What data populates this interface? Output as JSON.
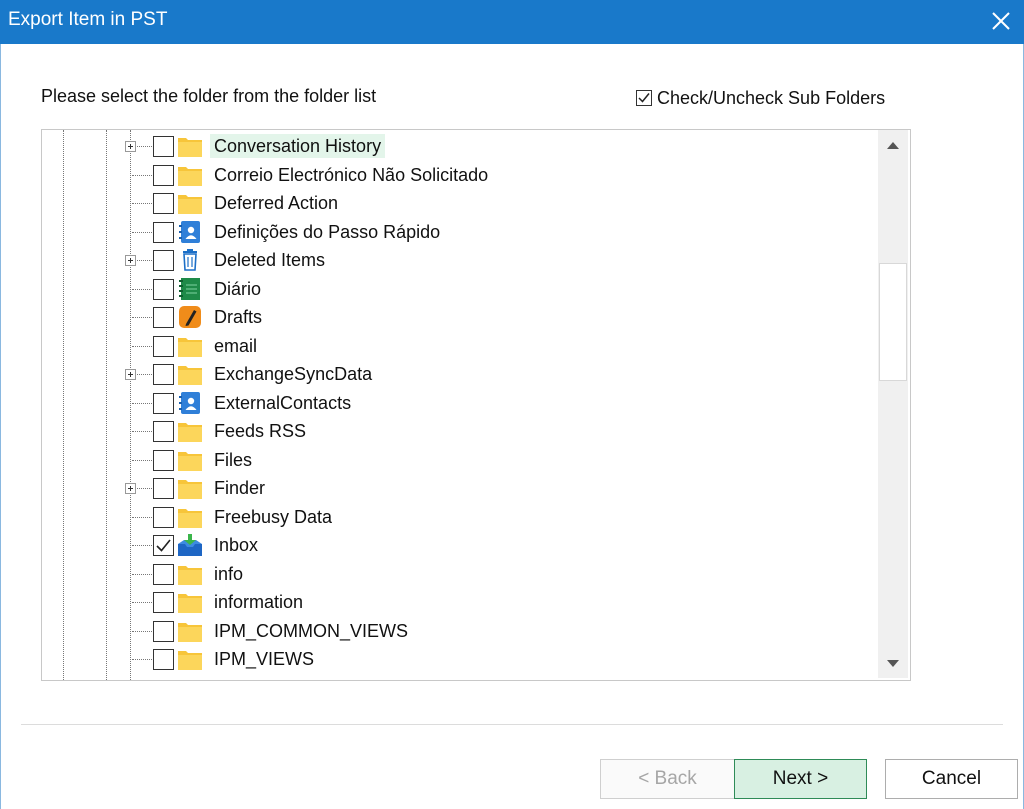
{
  "window": {
    "title": "Export Item in PST"
  },
  "dialog": {
    "prompt": "Please select the folder from the folder list",
    "subfolders_label": "Check/Uncheck Sub Folders",
    "subfolders_checked": true
  },
  "tree": {
    "items": [
      {
        "label": "Conversation History",
        "icon": "folder-icon",
        "expandable": true,
        "checked": false,
        "selected": true
      },
      {
        "label": "Correio Electrónico Não Solicitado",
        "icon": "folder-icon",
        "expandable": false,
        "checked": false
      },
      {
        "label": "Deferred Action",
        "icon": "folder-icon",
        "expandable": false,
        "checked": false
      },
      {
        "label": "Definições do Passo Rápido",
        "icon": "contacts-icon",
        "expandable": false,
        "checked": false
      },
      {
        "label": "Deleted Items",
        "icon": "trash-icon",
        "expandable": true,
        "checked": false
      },
      {
        "label": "Diário",
        "icon": "journal-icon",
        "expandable": false,
        "checked": false
      },
      {
        "label": "Drafts",
        "icon": "drafts-icon",
        "expandable": false,
        "checked": false
      },
      {
        "label": "email",
        "icon": "folder-icon",
        "expandable": false,
        "checked": false
      },
      {
        "label": "ExchangeSyncData",
        "icon": "folder-icon",
        "expandable": true,
        "checked": false
      },
      {
        "label": "ExternalContacts",
        "icon": "contacts-icon",
        "expandable": false,
        "checked": false
      },
      {
        "label": "Feeds RSS",
        "icon": "folder-icon",
        "expandable": false,
        "checked": false
      },
      {
        "label": "Files",
        "icon": "folder-icon",
        "expandable": false,
        "checked": false
      },
      {
        "label": "Finder",
        "icon": "folder-icon",
        "expandable": true,
        "checked": false
      },
      {
        "label": "Freebusy Data",
        "icon": "folder-icon",
        "expandable": false,
        "checked": false
      },
      {
        "label": "Inbox",
        "icon": "inbox-icon",
        "expandable": false,
        "checked": true
      },
      {
        "label": "info",
        "icon": "folder-icon",
        "expandable": false,
        "checked": false
      },
      {
        "label": "information",
        "icon": "folder-icon",
        "expandable": false,
        "checked": false
      },
      {
        "label": "IPM_COMMON_VIEWS",
        "icon": "folder-icon",
        "expandable": false,
        "checked": false
      },
      {
        "label": "IPM_VIEWS",
        "icon": "folder-icon",
        "expandable": false,
        "checked": false
      }
    ]
  },
  "buttons": {
    "back": "< Back",
    "next": "Next >",
    "cancel": "Cancel"
  },
  "colors": {
    "titlebar": "#1979ca",
    "folder": "#f7c53a",
    "next_button_bg": "#d8f0e2",
    "next_button_border": "#2e8b57",
    "selected_row_bg": "#e3f5ea"
  }
}
